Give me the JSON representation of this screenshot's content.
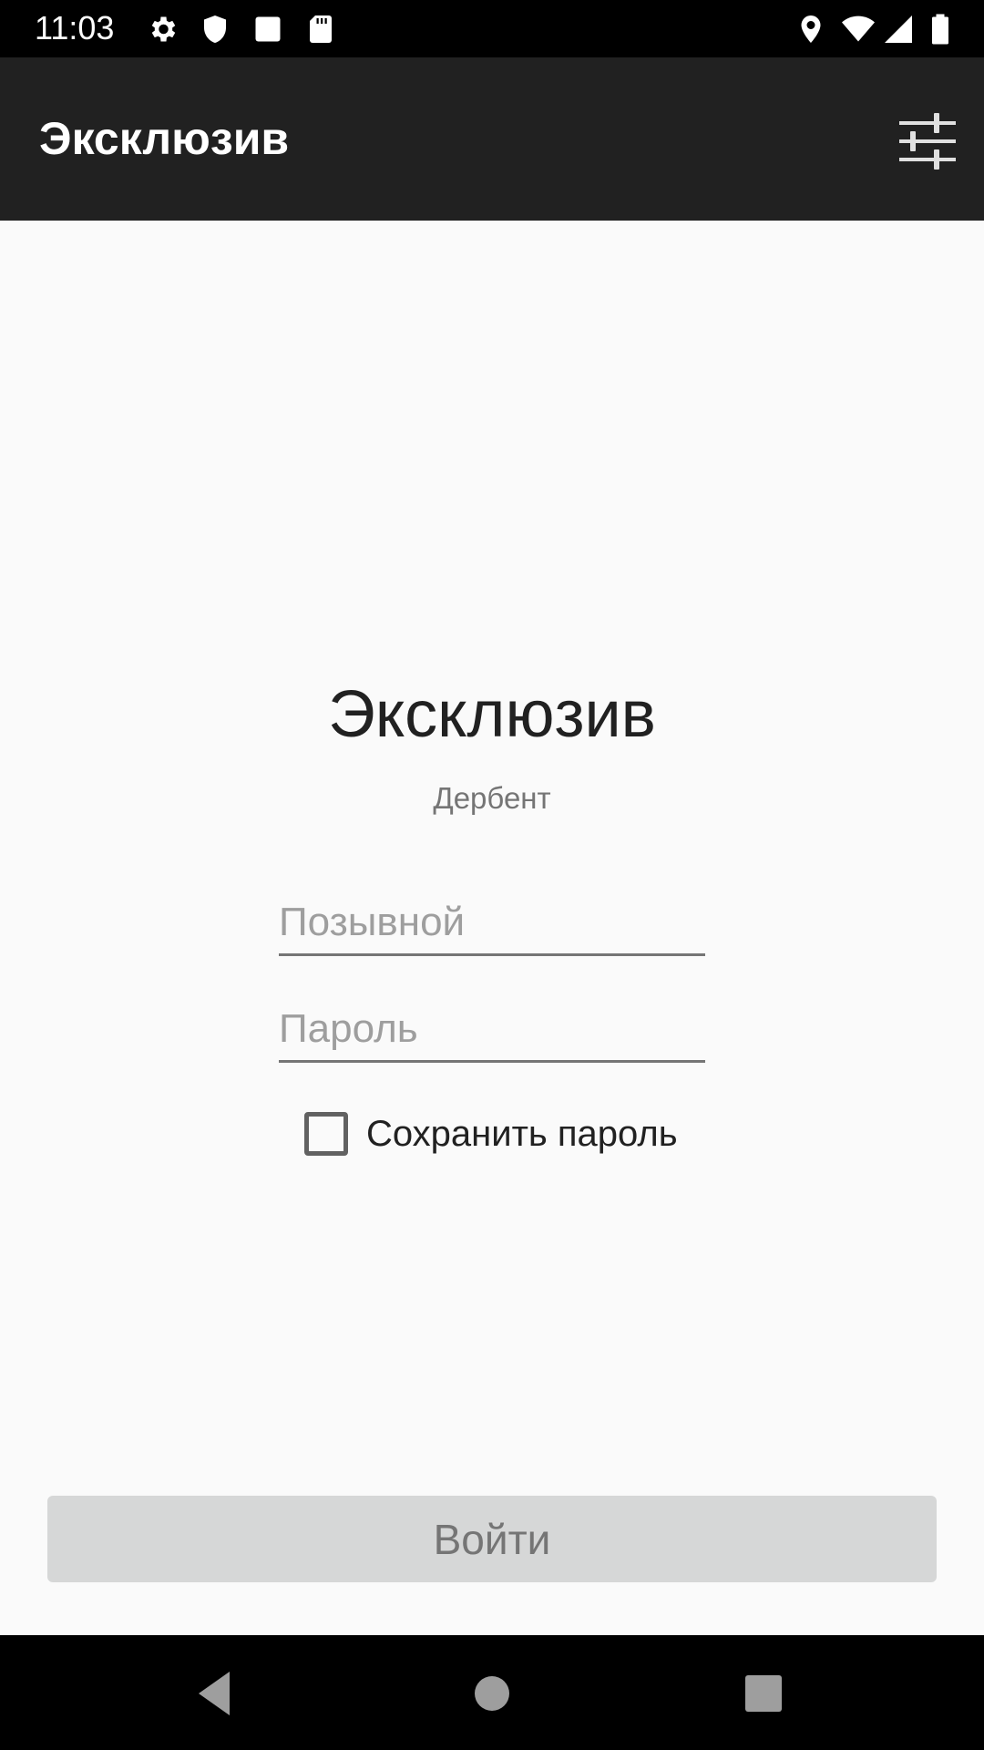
{
  "status_bar": {
    "time": "11:03",
    "icons_left": [
      "gear-icon",
      "shield-icon",
      "square-notification-icon",
      "sd-card-icon"
    ],
    "icons_right": [
      "location-icon",
      "wifi-icon",
      "signal-icon",
      "battery-icon"
    ]
  },
  "app_bar": {
    "title": "Эксклюзив",
    "action_icon": "sliders-settings-icon"
  },
  "login_form": {
    "brand_title": "Эксклюзив",
    "brand_subtitle": "Дербент",
    "callsign_placeholder": "Позывной",
    "callsign_value": "",
    "password_placeholder": "Пароль",
    "password_value": "",
    "remember_label": "Сохранить пароль",
    "remember_checked": false,
    "submit_label": "Войти"
  },
  "nav_bar": {
    "buttons": [
      "back-icon",
      "home-icon",
      "recents-icon"
    ]
  },
  "colors": {
    "app_bar": "#212121",
    "background": "#fafafa",
    "button_disabled_bg": "#d6d7d7",
    "button_disabled_text": "#757575"
  }
}
